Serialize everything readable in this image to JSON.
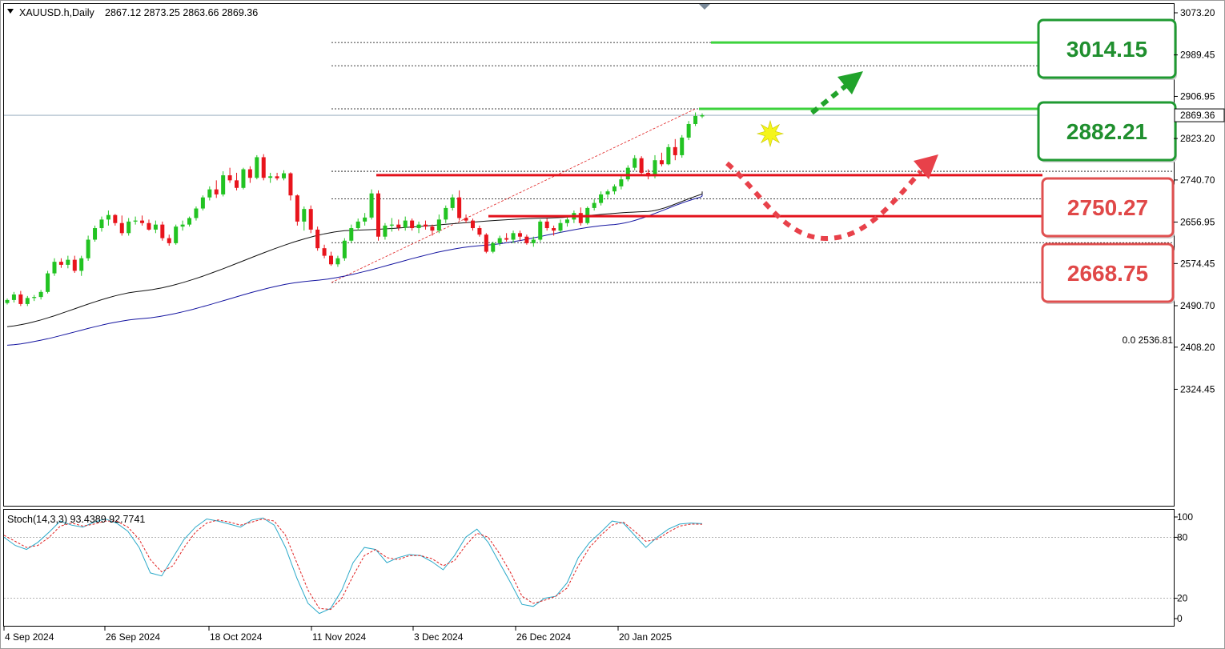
{
  "header": {
    "symbol": "XAUUSD.h,Daily",
    "ohlc": "2867.12 2873.25 2863.66 2869.36"
  },
  "price_axis": {
    "ticks": [
      "3073.20",
      "2989.45",
      "2906.95",
      "2823.20",
      "2740.70",
      "2656.95",
      "2574.45",
      "2490.70",
      "2408.20",
      "2324.45"
    ],
    "current_price": "2869.36"
  },
  "fib_label": "0.0 2536.81",
  "levels": [
    {
      "value": "3014.15",
      "kind": "resistance"
    },
    {
      "value": "2882.21",
      "kind": "resistance"
    },
    {
      "value": "2750.27",
      "kind": "support"
    },
    {
      "value": "2668.75",
      "kind": "support"
    }
  ],
  "oscillator": {
    "label": "Stoch(14,3,3) 93.4389 92.7741",
    "ticks": [
      "100",
      "80",
      "20",
      "0"
    ]
  },
  "time_axis": {
    "labels": [
      "4 Sep 2024",
      "26 Sep 2024",
      "18 Oct 2024",
      "11 Nov 2024",
      "3 Dec 2024",
      "26 Dec 2024",
      "20 Jan 2025"
    ]
  },
  "colors": {
    "bull": "#22c322",
    "bear": "#e8141c",
    "green_level": "#3cd23c",
    "red_level": "#e3111b",
    "green_box_border": "#1f9a32",
    "green_box_text": "#1f8f2e",
    "red_box_border": "#e05050",
    "red_box_text": "#e04848",
    "ma_black": "#111111",
    "ma_blue": "#1515a0"
  },
  "chart_data": {
    "type": "candlestick",
    "instrument": "XAUUSD.h",
    "timeframe": "Daily",
    "y_range": [
      2290,
      3090
    ],
    "candles": [
      [
        2496,
        2505,
        2493,
        2502
      ],
      [
        2502,
        2518,
        2497,
        2513
      ],
      [
        2513,
        2520,
        2490,
        2494
      ],
      [
        2494,
        2510,
        2490,
        2506
      ],
      [
        2506,
        2512,
        2500,
        2508
      ],
      [
        2508,
        2522,
        2503,
        2518
      ],
      [
        2518,
        2560,
        2515,
        2555
      ],
      [
        2555,
        2585,
        2550,
        2578
      ],
      [
        2578,
        2585,
        2566,
        2572
      ],
      [
        2572,
        2590,
        2565,
        2582
      ],
      [
        2582,
        2590,
        2556,
        2560
      ],
      [
        2560,
        2590,
        2550,
        2585
      ],
      [
        2585,
        2630,
        2580,
        2622
      ],
      [
        2622,
        2650,
        2618,
        2645
      ],
      [
        2645,
        2668,
        2638,
        2662
      ],
      [
        2662,
        2680,
        2650,
        2671
      ],
      [
        2671,
        2673,
        2650,
        2655
      ],
      [
        2655,
        2670,
        2630,
        2635
      ],
      [
        2635,
        2665,
        2630,
        2658
      ],
      [
        2658,
        2668,
        2652,
        2660
      ],
      [
        2660,
        2670,
        2650,
        2655
      ],
      [
        2655,
        2662,
        2640,
        2642
      ],
      [
        2642,
        2660,
        2635,
        2652
      ],
      [
        2652,
        2658,
        2620,
        2625
      ],
      [
        2625,
        2632,
        2610,
        2615
      ],
      [
        2615,
        2652,
        2612,
        2648
      ],
      [
        2648,
        2660,
        2640,
        2652
      ],
      [
        2652,
        2668,
        2648,
        2665
      ],
      [
        2665,
        2688,
        2660,
        2684
      ],
      [
        2684,
        2710,
        2680,
        2706
      ],
      [
        2706,
        2728,
        2700,
        2722
      ],
      [
        2722,
        2740,
        2705,
        2712
      ],
      [
        2712,
        2758,
        2708,
        2750
      ],
      [
        2750,
        2765,
        2735,
        2740
      ],
      [
        2740,
        2755,
        2720,
        2725
      ],
      [
        2725,
        2765,
        2722,
        2762
      ],
      [
        2762,
        2768,
        2735,
        2745
      ],
      [
        2745,
        2790,
        2742,
        2786
      ],
      [
        2786,
        2792,
        2740,
        2745
      ],
      [
        2745,
        2755,
        2735,
        2748
      ],
      [
        2748,
        2755,
        2740,
        2744
      ],
      [
        2744,
        2760,
        2740,
        2754
      ],
      [
        2754,
        2756,
        2700,
        2710
      ],
      [
        2710,
        2712,
        2650,
        2658
      ],
      [
        2658,
        2688,
        2640,
        2683
      ],
      [
        2683,
        2690,
        2635,
        2642
      ],
      [
        2642,
        2648,
        2600,
        2605
      ],
      [
        2605,
        2612,
        2585,
        2590
      ],
      [
        2590,
        2598,
        2570,
        2573
      ],
      [
        2573,
        2590,
        2568,
        2585
      ],
      [
        2585,
        2625,
        2580,
        2620
      ],
      [
        2620,
        2652,
        2616,
        2645
      ],
      [
        2645,
        2664,
        2640,
        2658
      ],
      [
        2658,
        2675,
        2650,
        2666
      ],
      [
        2666,
        2722,
        2662,
        2714
      ],
      [
        2714,
        2720,
        2620,
        2628
      ],
      [
        2628,
        2655,
        2622,
        2650
      ],
      [
        2650,
        2665,
        2638,
        2652
      ],
      [
        2652,
        2662,
        2640,
        2646
      ],
      [
        2646,
        2668,
        2640,
        2660
      ],
      [
        2660,
        2664,
        2640,
        2645
      ],
      [
        2645,
        2658,
        2635,
        2652
      ],
      [
        2652,
        2660,
        2642,
        2648
      ],
      [
        2648,
        2652,
        2630,
        2640
      ],
      [
        2640,
        2672,
        2635,
        2662
      ],
      [
        2662,
        2690,
        2655,
        2685
      ],
      [
        2685,
        2712,
        2680,
        2706
      ],
      [
        2706,
        2720,
        2660,
        2665
      ],
      [
        2665,
        2672,
        2655,
        2660
      ],
      [
        2660,
        2664,
        2640,
        2645
      ],
      [
        2645,
        2650,
        2628,
        2632
      ],
      [
        2632,
        2635,
        2595,
        2598
      ],
      [
        2598,
        2618,
        2595,
        2615
      ],
      [
        2615,
        2630,
        2610,
        2625
      ],
      [
        2625,
        2635,
        2618,
        2622
      ],
      [
        2622,
        2640,
        2615,
        2635
      ],
      [
        2635,
        2640,
        2620,
        2628
      ],
      [
        2628,
        2632,
        2612,
        2615
      ],
      [
        2615,
        2628,
        2608,
        2622
      ],
      [
        2622,
        2662,
        2618,
        2658
      ],
      [
        2658,
        2664,
        2640,
        2645
      ],
      [
        2645,
        2650,
        2630,
        2640
      ],
      [
        2640,
        2662,
        2636,
        2655
      ],
      [
        2655,
        2668,
        2648,
        2662
      ],
      [
        2662,
        2680,
        2655,
        2675
      ],
      [
        2675,
        2686,
        2650,
        2655
      ],
      [
        2655,
        2688,
        2652,
        2685
      ],
      [
        2685,
        2702,
        2680,
        2695
      ],
      [
        2695,
        2718,
        2690,
        2712
      ],
      [
        2712,
        2722,
        2705,
        2718
      ],
      [
        2718,
        2732,
        2712,
        2728
      ],
      [
        2728,
        2748,
        2722,
        2742
      ],
      [
        2742,
        2770,
        2738,
        2765
      ],
      [
        2765,
        2790,
        2760,
        2784
      ],
      [
        2784,
        2788,
        2750,
        2755
      ],
      [
        2755,
        2762,
        2742,
        2748
      ],
      [
        2748,
        2790,
        2744,
        2780
      ],
      [
        2780,
        2795,
        2768,
        2772
      ],
      [
        2772,
        2812,
        2770,
        2806
      ],
      [
        2806,
        2822,
        2780,
        2790
      ],
      [
        2790,
        2830,
        2785,
        2825
      ],
      [
        2825,
        2858,
        2820,
        2852
      ],
      [
        2852,
        2875,
        2848,
        2868
      ],
      [
        2867.12,
        2873.25,
        2863.66,
        2869.36
      ]
    ],
    "moving_averages": [
      {
        "color": "black",
        "points": [
          [
            0,
            2449
          ],
          [
            20,
            2520
          ],
          [
            50,
            2640
          ],
          [
            80,
            2665
          ],
          [
            95,
            2678
          ],
          [
            105,
            2718
          ]
        ]
      },
      {
        "color": "blue",
        "points": [
          [
            0,
            2412
          ],
          [
            20,
            2465
          ],
          [
            45,
            2540
          ],
          [
            70,
            2610
          ],
          [
            90,
            2652
          ],
          [
            105,
            2712
          ]
        ]
      }
    ],
    "fibonacci_lines": [
      2536.81,
      2616,
      2703,
      2758,
      2882.21,
      2968,
      3014.15
    ],
    "horizontal_levels": {
      "resistance": [
        3014.15,
        2882.21
      ],
      "support": [
        2750.27,
        2668.75
      ]
    },
    "current_price": 2869.36,
    "stochastic": {
      "params": "14,3,3",
      "k_last": 93.4389,
      "d_last": 92.7741,
      "y_range": [
        0,
        100
      ],
      "levels": [
        80,
        20
      ],
      "k": [
        80,
        72,
        68,
        75,
        85,
        96,
        92,
        90,
        95,
        98,
        94,
        86,
        70,
        45,
        42,
        60,
        78,
        90,
        98,
        96,
        93,
        90,
        97,
        99,
        92,
        70,
        40,
        15,
        5,
        10,
        28,
        55,
        70,
        68,
        55,
        60,
        63,
        62,
        56,
        48,
        62,
        80,
        88,
        75,
        55,
        35,
        14,
        12,
        20,
        22,
        35,
        60,
        75,
        85,
        96,
        94,
        82,
        70,
        80,
        88,
        93,
        94,
        93.4
      ],
      "d": [
        82,
        76,
        70,
        72,
        80,
        91,
        94,
        91,
        93,
        96,
        96,
        90,
        78,
        58,
        46,
        52,
        70,
        85,
        94,
        97,
        95,
        92,
        95,
        98,
        96,
        82,
        55,
        28,
        10,
        9,
        20,
        42,
        62,
        68,
        60,
        58,
        62,
        62,
        59,
        52,
        57,
        72,
        84,
        80,
        64,
        45,
        22,
        15,
        18,
        22,
        30,
        52,
        70,
        82,
        92,
        95,
        86,
        76,
        78,
        85,
        91,
        93,
        92.8
      ]
    },
    "annotations": {
      "projection_up": "green dashed arrow from 2882.21 breakout toward 3014.15",
      "projection_pullback": "red dashed arc dipping to ~2710 then rising back toward 2882.21",
      "breakout_marker": "yellow star at 2882.21"
    }
  }
}
